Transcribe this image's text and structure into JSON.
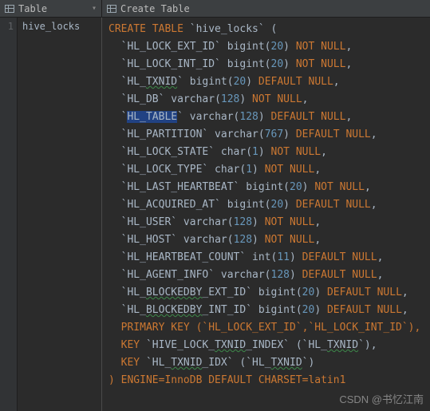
{
  "header": {
    "left_dropdown_label": "Table",
    "right_label": "Create Table"
  },
  "table_list": {
    "rows": [
      {
        "n": "1",
        "name": "hive_locks"
      }
    ]
  },
  "sql": {
    "table_name": "hive_locks",
    "engine_line": ") ENGINE=InnoDB DEFAULT CHARSET=latin1",
    "columns": [
      {
        "name": "HL_LOCK_EXT_ID",
        "type": "bigint",
        "len": "20",
        "tail": "NOT NULL",
        "squiggle": false
      },
      {
        "name": "HL_LOCK_INT_ID",
        "type": "bigint",
        "len": "20",
        "tail": "NOT NULL",
        "squiggle": false
      },
      {
        "name": "HL_TXNID",
        "type": "bigint",
        "len": "20",
        "tail": "DEFAULT NULL",
        "squiggle": true
      },
      {
        "name": "HL_DB",
        "type": "varchar",
        "len": "128",
        "tail": "NOT NULL",
        "squiggle": false
      },
      {
        "name": "HL_TABLE",
        "type": "varchar",
        "len": "128",
        "tail": "DEFAULT NULL",
        "squiggle": false,
        "selected": true
      },
      {
        "name": "HL_PARTITION",
        "type": "varchar",
        "len": "767",
        "tail": "DEFAULT NULL",
        "squiggle": false
      },
      {
        "name": "HL_LOCK_STATE",
        "type": "char",
        "len": "1",
        "tail": "NOT NULL",
        "squiggle": false
      },
      {
        "name": "HL_LOCK_TYPE",
        "type": "char",
        "len": "1",
        "tail": "NOT NULL",
        "squiggle": false
      },
      {
        "name": "HL_LAST_HEARTBEAT",
        "type": "bigint",
        "len": "20",
        "tail": "NOT NULL",
        "squiggle": false
      },
      {
        "name": "HL_ACQUIRED_AT",
        "type": "bigint",
        "len": "20",
        "tail": "DEFAULT NULL",
        "squiggle": false
      },
      {
        "name": "HL_USER",
        "type": "varchar",
        "len": "128",
        "tail": "NOT NULL",
        "squiggle": false
      },
      {
        "name": "HL_HOST",
        "type": "varchar",
        "len": "128",
        "tail": "NOT NULL",
        "squiggle": false
      },
      {
        "name": "HL_HEARTBEAT_COUNT",
        "type": "int",
        "len": "11",
        "tail": "DEFAULT NULL",
        "squiggle": false
      },
      {
        "name": "HL_AGENT_INFO",
        "type": "varchar",
        "len": "128",
        "tail": "DEFAULT NULL",
        "squiggle": false
      },
      {
        "name": "HL_BLOCKEDBY_EXT_ID",
        "type": "bigint",
        "len": "20",
        "tail": "DEFAULT NULL",
        "squiggle": true,
        "squiggle_part": "BLOCKEDBY"
      },
      {
        "name": "HL_BLOCKEDBY_INT_ID",
        "type": "bigint",
        "len": "20",
        "tail": "DEFAULT NULL",
        "squiggle": true,
        "squiggle_part": "BLOCKEDBY"
      }
    ],
    "keys": {
      "primary": "PRIMARY KEY (`HL_LOCK_EXT_ID`,`HL_LOCK_INT_ID`),",
      "key1_prefix": "KEY `HIVE_LOCK_",
      "key1_mid": "TXNID",
      "key1_suffix": "_INDEX` (`HL_",
      "key1_col": "TXNID",
      "key1_end": "`),",
      "key2_prefix": "KEY `HL_",
      "key2_mid": "TXNID",
      "key2_suffix": "_IDX` (`HL_",
      "key2_col": "TXNID",
      "key2_end": "`)"
    }
  },
  "watermark": "CSDN @书忆江南"
}
